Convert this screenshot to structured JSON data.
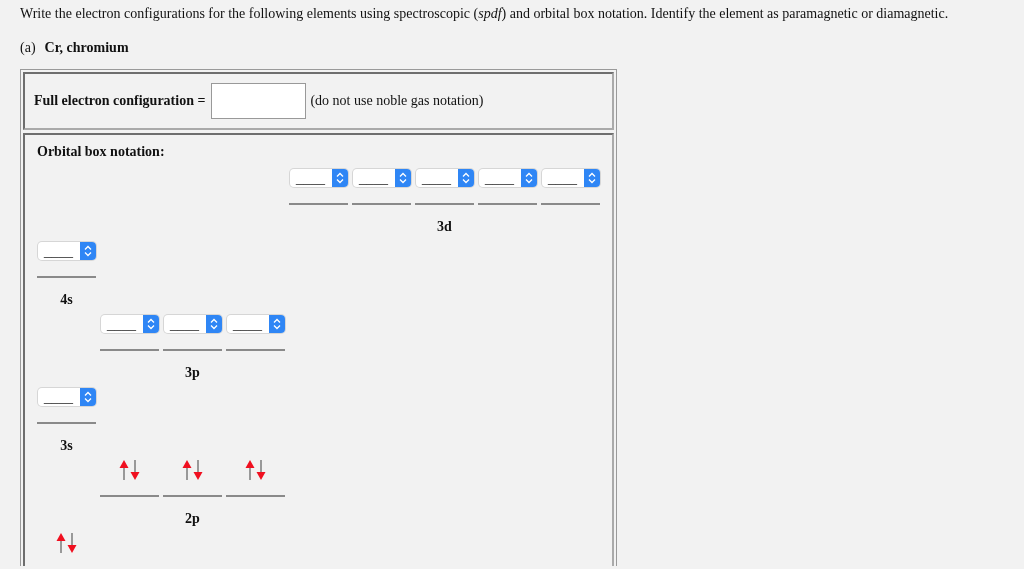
{
  "instruction": "Write the electron configurations for the following elements using spectroscopic (*spdf*) and orbital box notation. Identify the element as paramagnetic or diamagnetic.",
  "part": {
    "letter": "(a)",
    "element": "Cr, chromium"
  },
  "full_configuration": {
    "label": "Full electron configuration =",
    "note": "(do not use noble gas notation)"
  },
  "orbital_box": {
    "heading": "Orbital box notation:",
    "sublevels": [
      {
        "kind": "d_orbitals",
        "label": "3d",
        "orbitals": [
          {
            "kind": "dropdown",
            "value": "____"
          },
          {
            "kind": "dropdown",
            "value": "____"
          },
          {
            "kind": "dropdown",
            "value": "____"
          },
          {
            "kind": "dropdown",
            "value": "____"
          },
          {
            "kind": "dropdown",
            "value": "____"
          }
        ]
      },
      {
        "kind": "s_orbitals",
        "label": "4s",
        "orbitals": [
          {
            "kind": "dropdown",
            "value": "____"
          }
        ]
      },
      {
        "kind": "p_orbitals",
        "label": "3p",
        "orbitals": [
          {
            "kind": "dropdown",
            "value": "____"
          },
          {
            "kind": "dropdown",
            "value": "____"
          },
          {
            "kind": "dropdown",
            "value": "____"
          }
        ]
      },
      {
        "kind": "s_orbitals",
        "label": "3s",
        "orbitals": [
          {
            "kind": "dropdown",
            "value": "____"
          }
        ]
      },
      {
        "kind": "p_orbitals",
        "label": "2p",
        "orbitals": [
          {
            "kind": "paired"
          },
          {
            "kind": "paired"
          },
          {
            "kind": "paired"
          }
        ]
      },
      {
        "kind": "s_orbitals",
        "orbitals": [
          {
            "kind": "paired"
          }
        ]
      }
    ]
  }
}
